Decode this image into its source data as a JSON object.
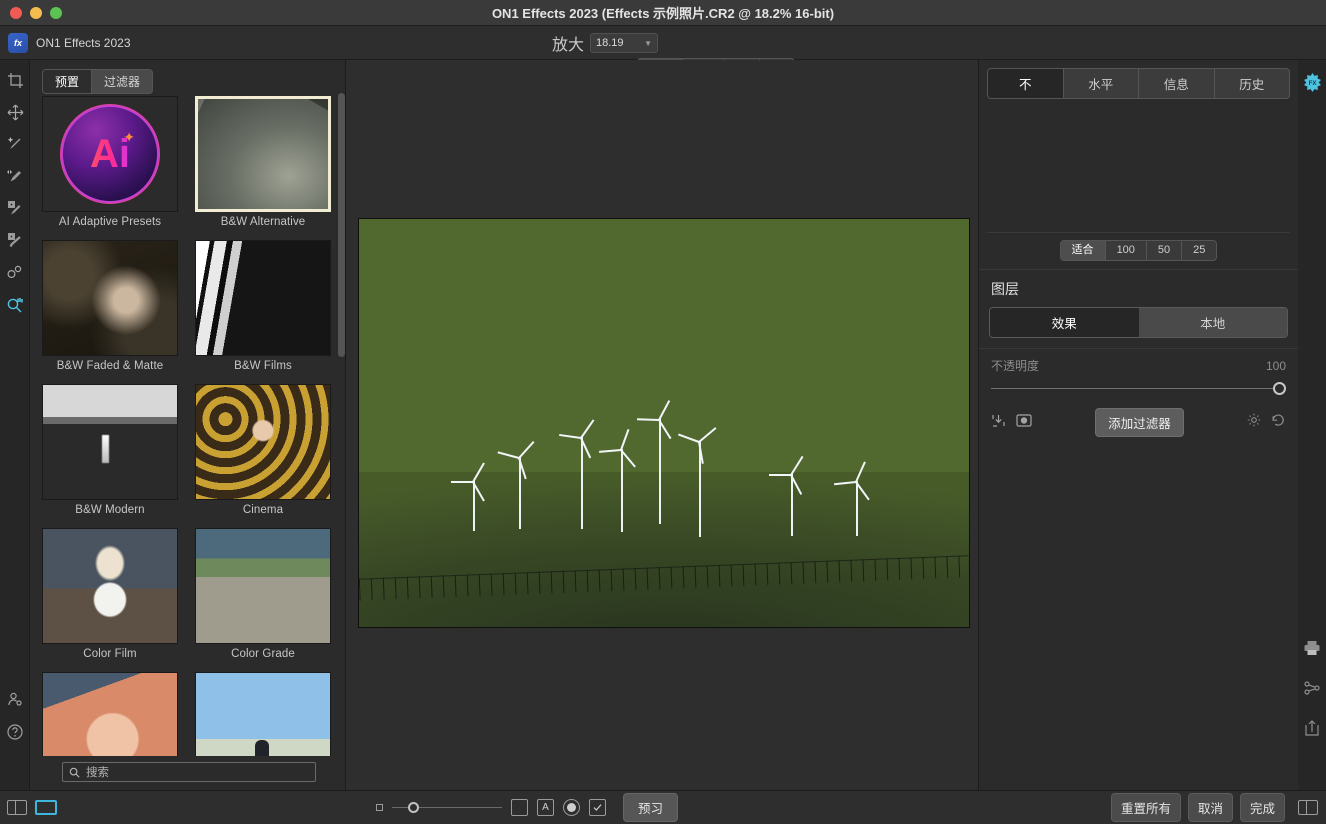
{
  "window": {
    "title": "ON1 Effects 2023 (Effects 示例照片.CR2 @ 18.2% 16-bit)",
    "app_name": "ON1 Effects 2023",
    "app_icon": "fx-star-icon"
  },
  "toolbar": {
    "zoom_label": "放大",
    "zoom_value": "18.19",
    "fit_segments": [
      "适合",
      "100",
      "50",
      "25"
    ],
    "fit_active": "适合"
  },
  "left_rail": {
    "tools": [
      {
        "name": "crop-tool",
        "label": "裁剪"
      },
      {
        "name": "move-tool",
        "label": "移动"
      },
      {
        "name": "retouch-brush-tool",
        "label": "修复画笔"
      },
      {
        "name": "perfect-brush-tool",
        "label": "完美画笔"
      },
      {
        "name": "masking-brush-tool",
        "label": "蒙版画笔"
      },
      {
        "name": "masking-bug-tool",
        "label": "蒙版工具"
      },
      {
        "name": "blend-tool",
        "label": "混合"
      },
      {
        "name": "zoom-pan-tool",
        "label": "缩放/平移",
        "selected": true
      }
    ],
    "bottom_tools": [
      {
        "name": "account-icon",
        "label": "账户"
      },
      {
        "name": "help-icon",
        "label": "帮助"
      }
    ]
  },
  "left_panel": {
    "tabs": [
      {
        "label": "预置",
        "active": true
      },
      {
        "label": "过滤器",
        "active": false
      }
    ],
    "presets": [
      {
        "label": "AI Adaptive Presets",
        "thumb": "ai-logo",
        "selected": false
      },
      {
        "label": "B&W Alternative",
        "thumb": "bw-alternative",
        "selected": true
      },
      {
        "label": "B&W Faded & Matte",
        "thumb": "bw-faded",
        "selected": false
      },
      {
        "label": "B&W Films",
        "thumb": "bw-films",
        "selected": false
      },
      {
        "label": "B&W Modern",
        "thumb": "bw-modern",
        "selected": false
      },
      {
        "label": "Cinema",
        "thumb": "cinema",
        "selected": false
      },
      {
        "label": "Color Film",
        "thumb": "color-film",
        "selected": false
      },
      {
        "label": "Color Grade",
        "thumb": "color-grade",
        "selected": false
      },
      {
        "label": "",
        "thumb": "cross-process",
        "selected": false
      },
      {
        "label": "",
        "thumb": "sky-portrait",
        "selected": false
      }
    ],
    "search": {
      "placeholder": "搜索",
      "value": "",
      "icon": "search-icon"
    }
  },
  "right_panel": {
    "tabs": [
      {
        "label": "不",
        "active": true
      },
      {
        "label": "水平",
        "active": false
      },
      {
        "label": "信息",
        "active": false
      },
      {
        "label": "历史",
        "active": false
      }
    ],
    "fit_segments": [
      "适合",
      "100",
      "50",
      "25"
    ],
    "fit_active": "适合",
    "layers_title": "图层",
    "layer_modes": [
      {
        "label": "效果",
        "active": true
      },
      {
        "label": "本地",
        "active": false
      }
    ],
    "opacity": {
      "label": "不透明度",
      "value": "100"
    },
    "add_filter_label": "添加过滤器",
    "row_icons": [
      {
        "name": "save-preset-icon"
      },
      {
        "name": "mask-icon"
      },
      {
        "name": "gear-icon"
      },
      {
        "name": "reset-icon"
      }
    ]
  },
  "edge_rail": {
    "icons": [
      {
        "name": "fx-star-icon",
        "color": "#4ec3e0"
      },
      {
        "name": "print-icon"
      },
      {
        "name": "share-icon"
      },
      {
        "name": "export-icon"
      }
    ]
  },
  "bottom_bar": {
    "left_icons": [
      {
        "name": "panel-toggle-icon"
      },
      {
        "name": "view-mode-icon",
        "color": "#3fb6dc"
      }
    ],
    "center": {
      "small_square_icon": "small-square-icon",
      "slider_value": "0",
      "icons": [
        {
          "name": "compare-square-icon"
        },
        {
          "name": "text-a-icon",
          "glyph": "A"
        },
        {
          "name": "soft-proof-circle-icon"
        },
        {
          "name": "checkbox-icon"
        }
      ],
      "preview_label": "预习"
    },
    "right": {
      "reset_all_label": "重置所有",
      "cancel_label": "取消",
      "done_label": "完成",
      "panel_icon": "right-panel-toggle-icon"
    }
  },
  "colors": {
    "accent": "#4ec3e0",
    "window_bg": "#2b2b2b",
    "titlebar_bg": "#3a3a3a",
    "selection_border": "#f2ecd3"
  }
}
